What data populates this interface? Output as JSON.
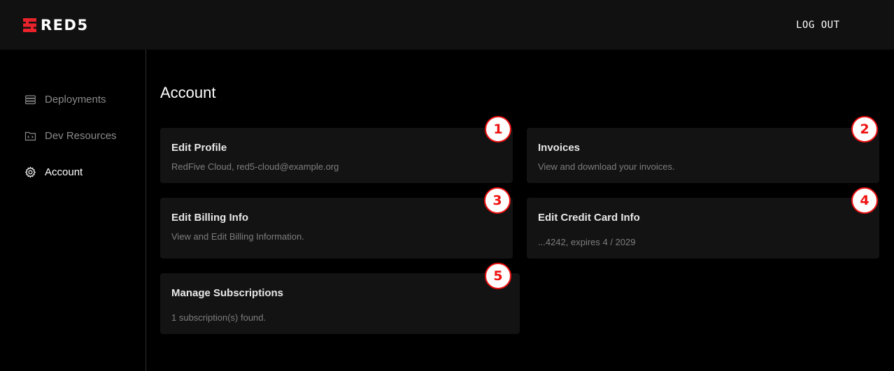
{
  "header": {
    "logo_text": "RED5",
    "logout_label": "LOG OUT",
    "brand_color": "#e8232b"
  },
  "sidebar": {
    "items": [
      {
        "label": "Deployments",
        "icon": "database-stack-icon",
        "active": false
      },
      {
        "label": "Dev Resources",
        "icon": "folder-code-icon",
        "active": false
      },
      {
        "label": "Account",
        "icon": "gear-icon",
        "active": true
      }
    ]
  },
  "main": {
    "title": "Account",
    "cards": [
      {
        "title": "Edit Profile",
        "subtitle": "RedFive Cloud, red5-cloud@example.org",
        "badge": "1"
      },
      {
        "title": "Invoices",
        "subtitle": "View and download your invoices.",
        "badge": "2"
      },
      {
        "title": "Edit Billing Info",
        "subtitle": "View and Edit Billing Information.",
        "badge": "3"
      },
      {
        "title": "Edit Credit Card Info",
        "subtitle": "...4242, expires 4 / 2029",
        "badge": "4"
      },
      {
        "title": "Manage Subscriptions",
        "subtitle": "1 subscription(s) found.",
        "badge": "5"
      }
    ]
  }
}
